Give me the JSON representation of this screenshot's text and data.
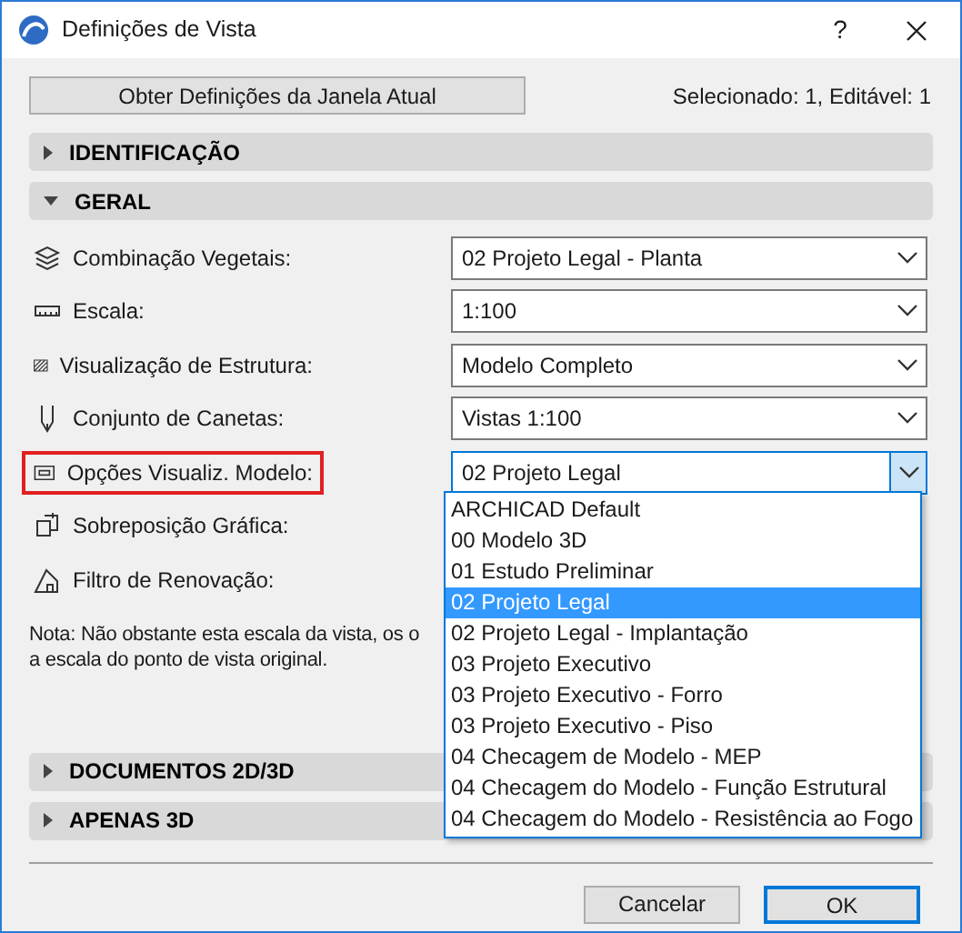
{
  "window": {
    "title": "Definições de Vista",
    "help": "?"
  },
  "get_settings_button": "Obter Definições da Janela Atual",
  "selection_info": "Selecionado: 1, Editável: 1",
  "sections_top": [
    {
      "title": "IDENTIFICAÇÃO",
      "expanded": false
    },
    {
      "title": "GERAL",
      "expanded": true
    }
  ],
  "fields": [
    {
      "kind": "select",
      "label": "Combinação Vegetais:",
      "value": "02 Projeto Legal - Planta",
      "highlighted": false,
      "open": false
    },
    {
      "kind": "select",
      "label": "Escala:",
      "value": "1:100",
      "highlighted": false,
      "open": false
    },
    {
      "kind": "select",
      "label": "Visualização de Estrutura:",
      "value": "Modelo Completo",
      "highlighted": false,
      "open": false
    },
    {
      "kind": "select",
      "label": "Conjunto de Canetas:",
      "value": "Vistas 1:100",
      "highlighted": false,
      "open": false
    },
    {
      "kind": "select",
      "label": "Opções Visualiz. Modelo:",
      "value": "02 Projeto Legal",
      "highlighted": true,
      "open": true
    },
    {
      "kind": "label",
      "label": "Sobreposição Gráfica:",
      "highlighted": false
    },
    {
      "kind": "label",
      "label": "Filtro de Renovação:",
      "highlighted": false
    }
  ],
  "note_lines": [
    "Nota: Não obstante esta escala da vista, os o",
    "a escala do ponto de vista original."
  ],
  "sections_bottom": [
    {
      "title": "DOCUMENTOS 2D/3D",
      "expanded": false
    },
    {
      "title": "APENAS 3D",
      "expanded": false
    }
  ],
  "dropdown_options": [
    {
      "label": "ARCHICAD Default",
      "selected": false
    },
    {
      "label": "00 Modelo 3D",
      "selected": false
    },
    {
      "label": "01 Estudo Preliminar",
      "selected": false
    },
    {
      "label": "02 Projeto Legal",
      "selected": true
    },
    {
      "label": "02 Projeto Legal - Implantação",
      "selected": false
    },
    {
      "label": "03 Projeto Executivo",
      "selected": false
    },
    {
      "label": "03 Projeto Executivo - Forro",
      "selected": false
    },
    {
      "label": "03 Projeto Executivo - Piso",
      "selected": false
    },
    {
      "label": "04 Checagem de Modelo - MEP",
      "selected": false
    },
    {
      "label": "04 Checagem do Modelo - Função Estrutural",
      "selected": false
    },
    {
      "label": "04 Checagem do Modelo - Resistência ao Fogo",
      "selected": false
    }
  ],
  "buttons": [
    {
      "label": "Cancelar",
      "default": false
    },
    {
      "label": "OK",
      "default": true
    }
  ]
}
